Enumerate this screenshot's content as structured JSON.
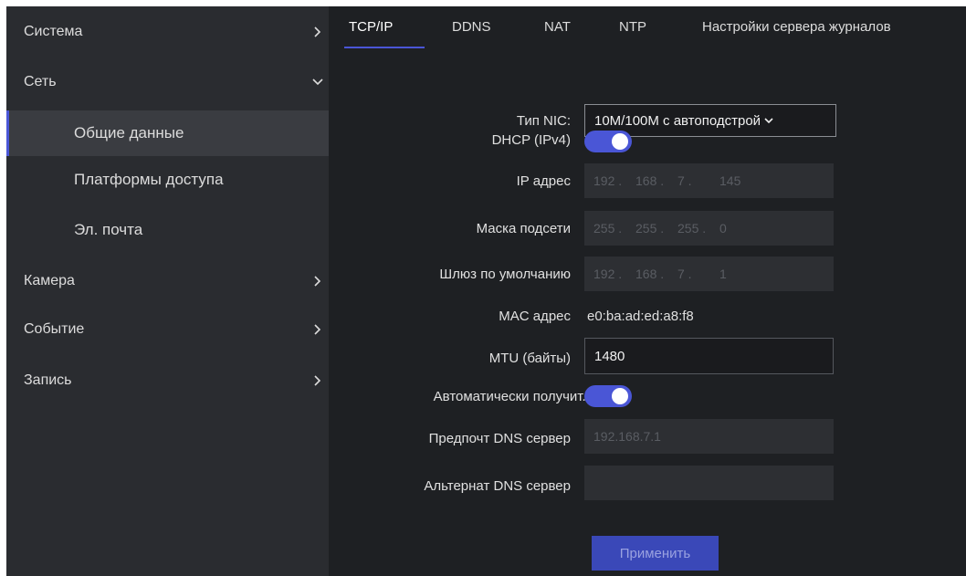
{
  "sidebar": {
    "items": [
      {
        "label": "Система"
      },
      {
        "label": "Сеть"
      },
      {
        "label": "Общие данные"
      },
      {
        "label": "Платформы доступа"
      },
      {
        "label": "Эл. почта"
      },
      {
        "label": "Камера"
      },
      {
        "label": "Событие"
      },
      {
        "label": "Запись"
      }
    ],
    "chevron_right": "›",
    "chevron_down": "⌄"
  },
  "tabs": [
    {
      "label": "TCP/IP"
    },
    {
      "label": "DDNS"
    },
    {
      "label": "NAT"
    },
    {
      "label": "NTP"
    },
    {
      "label": "Настройки сервера журналов"
    }
  ],
  "form": {
    "nic_type": {
      "label": "Тип NIC:",
      "value": "10M/100M с автоподстрой"
    },
    "dhcp": {
      "label": "DHCP (IPv4)",
      "enabled": true
    },
    "ip": {
      "label": "IP адрес",
      "segments": [
        "192",
        "168",
        "7",
        "145"
      ]
    },
    "mask": {
      "label": "Маска подсети",
      "segments": [
        "255",
        "255",
        "255",
        "0"
      ]
    },
    "gateway": {
      "label": "Шлюз по умолчанию",
      "segments": [
        "192",
        "168",
        "7",
        "1"
      ]
    },
    "mac": {
      "label": "MAC адрес",
      "value": "e0:ba:ad:ed:a8:f8"
    },
    "mtu": {
      "label": "MTU (байты)",
      "value": "1480"
    },
    "auto_dns": {
      "label": "Автоматически получит...",
      "enabled": true
    },
    "pref_dns": {
      "label": "Предпочт DNS сервер",
      "value": "192.168.7.1"
    },
    "alt_dns": {
      "label": "Альтернат DNS сервер",
      "value": ""
    },
    "ip_separator": "."
  },
  "apply_label": "Применить",
  "colors": {
    "accent": "#4a56d6",
    "sidebar": "#2a2c30",
    "main": "#1e2023"
  }
}
